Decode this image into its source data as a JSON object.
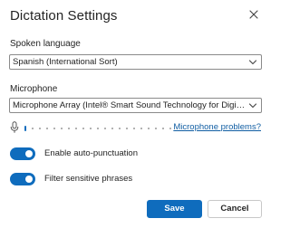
{
  "dialog": {
    "title": "Dictation Settings",
    "close_icon": "close-icon"
  },
  "spoken_language": {
    "label": "Spoken language",
    "selected": "Spanish (International Sort)"
  },
  "microphone": {
    "label": "Microphone",
    "selected": "Microphone Array (Intel® Smart Sound Technology for Digital Mi...",
    "icon": "microphone-icon",
    "problems_link": "Microphone problems?",
    "input_level": 0
  },
  "options": {
    "auto_punctuation": {
      "label": "Enable auto-punctuation",
      "on": true
    },
    "filter_phrases": {
      "label": "Filter sensitive phrases",
      "on": true
    }
  },
  "buttons": {
    "save": "Save",
    "cancel": "Cancel"
  },
  "colors": {
    "accent": "#0f6cbd",
    "link": "#115ea3"
  }
}
